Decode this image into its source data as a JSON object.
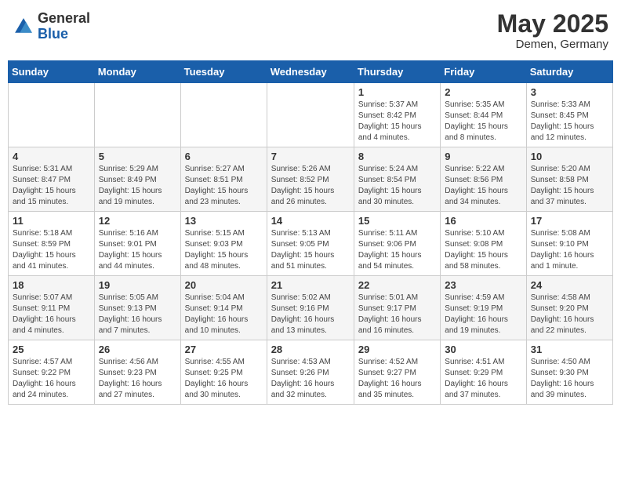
{
  "header": {
    "logo_general": "General",
    "logo_blue": "Blue",
    "month_year": "May 2025",
    "location": "Demen, Germany"
  },
  "weekdays": [
    "Sunday",
    "Monday",
    "Tuesday",
    "Wednesday",
    "Thursday",
    "Friday",
    "Saturday"
  ],
  "weeks": [
    [
      {
        "day": "",
        "detail": ""
      },
      {
        "day": "",
        "detail": ""
      },
      {
        "day": "",
        "detail": ""
      },
      {
        "day": "",
        "detail": ""
      },
      {
        "day": "1",
        "detail": "Sunrise: 5:37 AM\nSunset: 8:42 PM\nDaylight: 15 hours\nand 4 minutes."
      },
      {
        "day": "2",
        "detail": "Sunrise: 5:35 AM\nSunset: 8:44 PM\nDaylight: 15 hours\nand 8 minutes."
      },
      {
        "day": "3",
        "detail": "Sunrise: 5:33 AM\nSunset: 8:45 PM\nDaylight: 15 hours\nand 12 minutes."
      }
    ],
    [
      {
        "day": "4",
        "detail": "Sunrise: 5:31 AM\nSunset: 8:47 PM\nDaylight: 15 hours\nand 15 minutes."
      },
      {
        "day": "5",
        "detail": "Sunrise: 5:29 AM\nSunset: 8:49 PM\nDaylight: 15 hours\nand 19 minutes."
      },
      {
        "day": "6",
        "detail": "Sunrise: 5:27 AM\nSunset: 8:51 PM\nDaylight: 15 hours\nand 23 minutes."
      },
      {
        "day": "7",
        "detail": "Sunrise: 5:26 AM\nSunset: 8:52 PM\nDaylight: 15 hours\nand 26 minutes."
      },
      {
        "day": "8",
        "detail": "Sunrise: 5:24 AM\nSunset: 8:54 PM\nDaylight: 15 hours\nand 30 minutes."
      },
      {
        "day": "9",
        "detail": "Sunrise: 5:22 AM\nSunset: 8:56 PM\nDaylight: 15 hours\nand 34 minutes."
      },
      {
        "day": "10",
        "detail": "Sunrise: 5:20 AM\nSunset: 8:58 PM\nDaylight: 15 hours\nand 37 minutes."
      }
    ],
    [
      {
        "day": "11",
        "detail": "Sunrise: 5:18 AM\nSunset: 8:59 PM\nDaylight: 15 hours\nand 41 minutes."
      },
      {
        "day": "12",
        "detail": "Sunrise: 5:16 AM\nSunset: 9:01 PM\nDaylight: 15 hours\nand 44 minutes."
      },
      {
        "day": "13",
        "detail": "Sunrise: 5:15 AM\nSunset: 9:03 PM\nDaylight: 15 hours\nand 48 minutes."
      },
      {
        "day": "14",
        "detail": "Sunrise: 5:13 AM\nSunset: 9:05 PM\nDaylight: 15 hours\nand 51 minutes."
      },
      {
        "day": "15",
        "detail": "Sunrise: 5:11 AM\nSunset: 9:06 PM\nDaylight: 15 hours\nand 54 minutes."
      },
      {
        "day": "16",
        "detail": "Sunrise: 5:10 AM\nSunset: 9:08 PM\nDaylight: 15 hours\nand 58 minutes."
      },
      {
        "day": "17",
        "detail": "Sunrise: 5:08 AM\nSunset: 9:10 PM\nDaylight: 16 hours\nand 1 minute."
      }
    ],
    [
      {
        "day": "18",
        "detail": "Sunrise: 5:07 AM\nSunset: 9:11 PM\nDaylight: 16 hours\nand 4 minutes."
      },
      {
        "day": "19",
        "detail": "Sunrise: 5:05 AM\nSunset: 9:13 PM\nDaylight: 16 hours\nand 7 minutes."
      },
      {
        "day": "20",
        "detail": "Sunrise: 5:04 AM\nSunset: 9:14 PM\nDaylight: 16 hours\nand 10 minutes."
      },
      {
        "day": "21",
        "detail": "Sunrise: 5:02 AM\nSunset: 9:16 PM\nDaylight: 16 hours\nand 13 minutes."
      },
      {
        "day": "22",
        "detail": "Sunrise: 5:01 AM\nSunset: 9:17 PM\nDaylight: 16 hours\nand 16 minutes."
      },
      {
        "day": "23",
        "detail": "Sunrise: 4:59 AM\nSunset: 9:19 PM\nDaylight: 16 hours\nand 19 minutes."
      },
      {
        "day": "24",
        "detail": "Sunrise: 4:58 AM\nSunset: 9:20 PM\nDaylight: 16 hours\nand 22 minutes."
      }
    ],
    [
      {
        "day": "25",
        "detail": "Sunrise: 4:57 AM\nSunset: 9:22 PM\nDaylight: 16 hours\nand 24 minutes."
      },
      {
        "day": "26",
        "detail": "Sunrise: 4:56 AM\nSunset: 9:23 PM\nDaylight: 16 hours\nand 27 minutes."
      },
      {
        "day": "27",
        "detail": "Sunrise: 4:55 AM\nSunset: 9:25 PM\nDaylight: 16 hours\nand 30 minutes."
      },
      {
        "day": "28",
        "detail": "Sunrise: 4:53 AM\nSunset: 9:26 PM\nDaylight: 16 hours\nand 32 minutes."
      },
      {
        "day": "29",
        "detail": "Sunrise: 4:52 AM\nSunset: 9:27 PM\nDaylight: 16 hours\nand 35 minutes."
      },
      {
        "day": "30",
        "detail": "Sunrise: 4:51 AM\nSunset: 9:29 PM\nDaylight: 16 hours\nand 37 minutes."
      },
      {
        "day": "31",
        "detail": "Sunrise: 4:50 AM\nSunset: 9:30 PM\nDaylight: 16 hours\nand 39 minutes."
      }
    ]
  ]
}
